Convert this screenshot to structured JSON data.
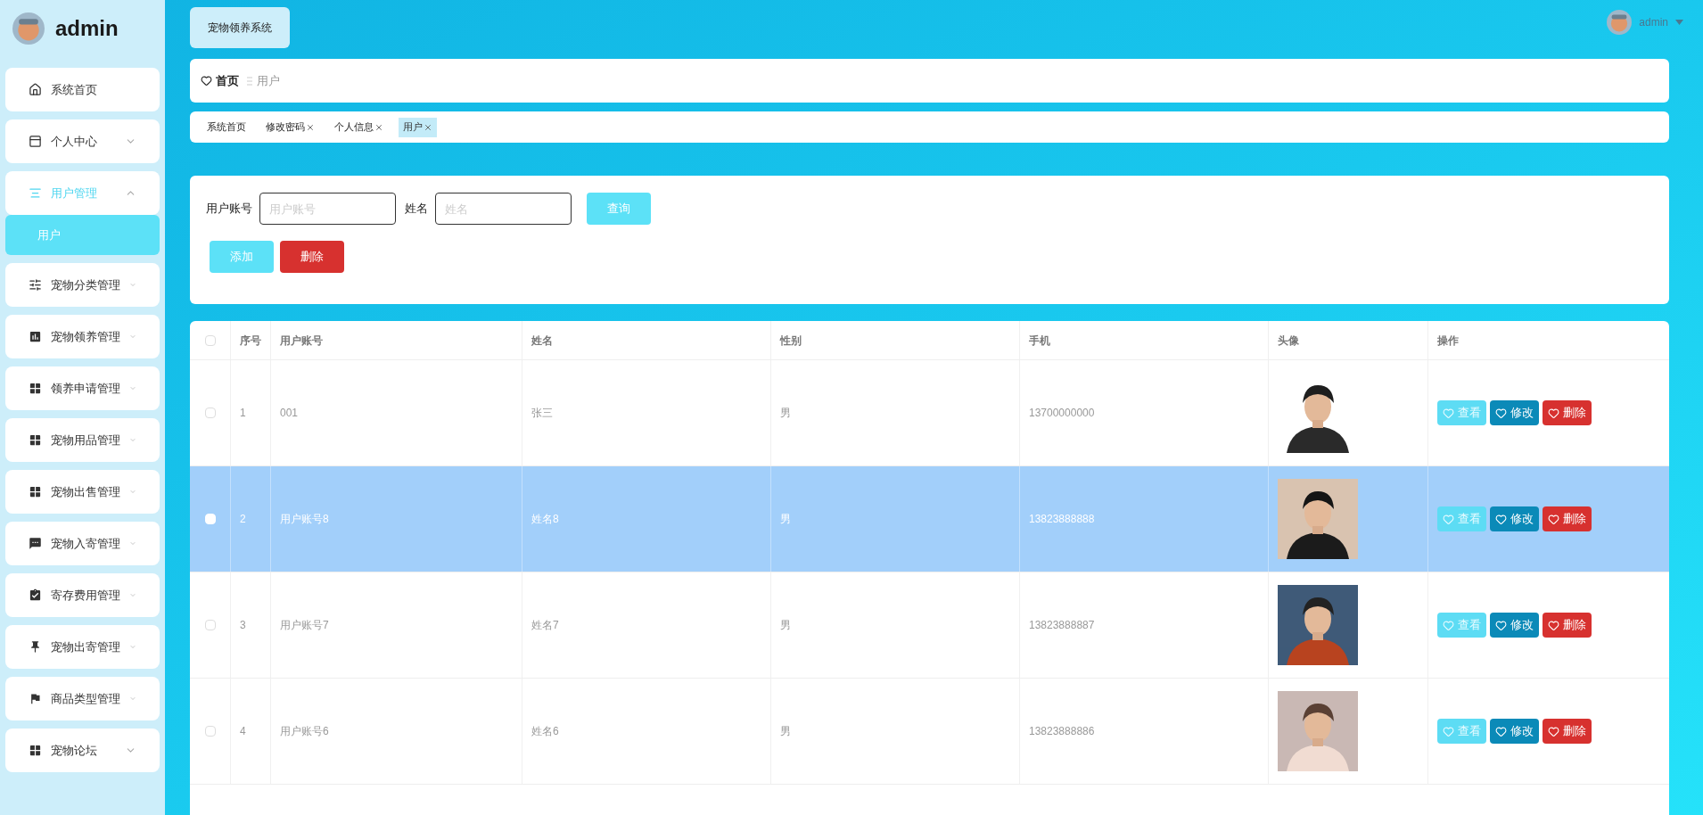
{
  "sidebar": {
    "user": "admin",
    "menu": [
      {
        "label": "系统首页",
        "kind": "home",
        "expandable": false,
        "expanded": false
      },
      {
        "label": "个人中心",
        "kind": "window",
        "expandable": true,
        "expanded": false
      },
      {
        "label": "用户管理",
        "kind": "lines",
        "expandable": true,
        "expanded": true,
        "children": [
          {
            "label": "用户",
            "selected": true
          }
        ]
      },
      {
        "label": "宠物分类管理",
        "kind": "sliders",
        "expandable": true,
        "expanded": false
      },
      {
        "label": "宠物领养管理",
        "kind": "chart",
        "expandable": true,
        "expanded": false
      },
      {
        "label": "领养申请管理",
        "kind": "grid",
        "expandable": true,
        "expanded": false
      },
      {
        "label": "宠物用品管理",
        "kind": "grid",
        "expandable": true,
        "expanded": false
      },
      {
        "label": "宠物出售管理",
        "kind": "grid",
        "expandable": true,
        "expanded": false
      },
      {
        "label": "宠物入寄管理",
        "kind": "chat",
        "expandable": true,
        "expanded": false
      },
      {
        "label": "寄存费用管理",
        "kind": "clipboard",
        "expandable": true,
        "expanded": false
      },
      {
        "label": "宠物出寄管理",
        "kind": "pin",
        "expandable": true,
        "expanded": false
      },
      {
        "label": "商品类型管理",
        "kind": "flag",
        "expandable": true,
        "expanded": false
      },
      {
        "label": "宠物论坛",
        "kind": "grid",
        "expandable": true,
        "expanded": false
      }
    ]
  },
  "header": {
    "system_name": "宠物领养系统",
    "user": "admin"
  },
  "breadcrumb": [
    {
      "label": "首页"
    },
    {
      "label": "用户"
    }
  ],
  "tabs": [
    {
      "label": "系统首页",
      "closable": false,
      "selected": false
    },
    {
      "label": "修改密码",
      "closable": true,
      "selected": false
    },
    {
      "label": "个人信息",
      "closable": true,
      "selected": false
    },
    {
      "label": "用户",
      "closable": true,
      "selected": true
    }
  ],
  "filters": [
    {
      "label": "用户账号",
      "placeholder": "用户账号"
    },
    {
      "label": "姓名",
      "placeholder": "姓名"
    }
  ],
  "search_button": "查询",
  "actions": [
    {
      "label": "添加",
      "kind": "add"
    },
    {
      "label": "删除",
      "kind": "delete"
    }
  ],
  "table": {
    "select_all": {
      "checked": false
    },
    "columns": [
      "序号",
      "用户账号",
      "姓名",
      "性别",
      "手机",
      "头像",
      "操作"
    ],
    "rows": [
      {
        "index": "1",
        "account": "001",
        "name": "张三",
        "gender": "男",
        "phone": "13700000000",
        "selected": false,
        "avatar": {
          "kind": "picture"
        },
        "actions": [
          {
            "label": "查看",
            "kind": "view"
          },
          {
            "label": "修改",
            "kind": "edit"
          },
          {
            "label": "删除",
            "kind": "delete"
          }
        ]
      },
      {
        "index": "2",
        "account": "用户账号8",
        "name": "姓名8",
        "gender": "男",
        "phone": "13823888888",
        "selected": true,
        "avatar": {
          "kind": "picture"
        },
        "actions": [
          {
            "label": "查看",
            "kind": "view"
          },
          {
            "label": "修改",
            "kind": "edit"
          },
          {
            "label": "删除",
            "kind": "delete"
          }
        ]
      },
      {
        "index": "3",
        "account": "用户账号7",
        "name": "姓名7",
        "gender": "男",
        "phone": "13823888887",
        "selected": false,
        "avatar": {
          "kind": "picture"
        },
        "actions": [
          {
            "label": "查看",
            "kind": "view"
          },
          {
            "label": "修改",
            "kind": "edit"
          },
          {
            "label": "删除",
            "kind": "delete"
          }
        ]
      },
      {
        "index": "4",
        "account": "用户账号6",
        "name": "姓名6",
        "gender": "男",
        "phone": "13823888886",
        "selected": false,
        "avatar": {
          "kind": "picture"
        },
        "actions": [
          {
            "label": "查看",
            "kind": "view"
          },
          {
            "label": "修改",
            "kind": "edit"
          },
          {
            "label": "删除",
            "kind": "delete"
          }
        ]
      }
    ]
  }
}
